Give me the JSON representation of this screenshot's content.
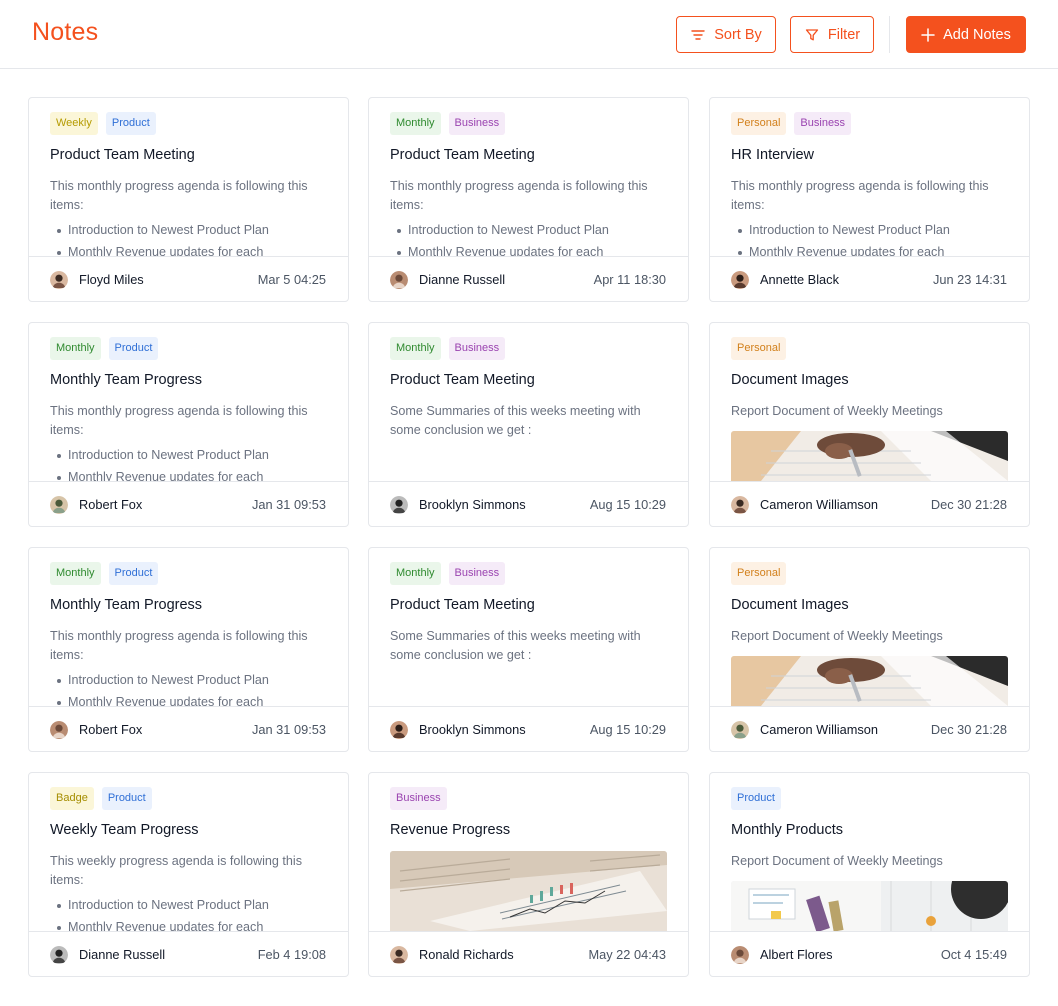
{
  "header": {
    "title": "Notes",
    "sort_label": "Sort By",
    "filter_label": "Filter",
    "add_label": "Add Notes"
  },
  "colors": {
    "accent": "#f4511e"
  },
  "cards": [
    {
      "tags": [
        "Weekly",
        "Product"
      ],
      "title": "Product Team Meeting",
      "text": "This monthly progress agenda is following this items:",
      "list": [
        "Introduction to Newest Product Plan",
        "Monthly Revenue updates for each"
      ],
      "author": "Floyd Miles",
      "date": "Mar 5 04:25"
    },
    {
      "tags": [
        "Monthly",
        "Business"
      ],
      "title": "Product Team Meeting",
      "text": "This monthly progress agenda is following this items:",
      "list": [
        "Introduction to Newest Product Plan",
        "Monthly Revenue updates for each"
      ],
      "author": "Dianne Russell",
      "date": "Apr 11 18:30"
    },
    {
      "tags": [
        "Personal",
        "Business"
      ],
      "title": "HR Interview",
      "text": "This monthly progress agenda is following this items:",
      "list": [
        "Introduction to Newest Product Plan",
        "Monthly Revenue updates for each"
      ],
      "author": "Annette Black",
      "date": "Jun 23 14:31"
    },
    {
      "tags": [
        "Monthly",
        "Product"
      ],
      "title": "Monthly Team Progress",
      "text": "This monthly progress agenda is following this items:",
      "list": [
        "Introduction to Newest Product Plan",
        "Monthly Revenue updates for each"
      ],
      "author": "Robert Fox",
      "date": "Jan 31 09:53"
    },
    {
      "tags": [
        "Monthly",
        "Business"
      ],
      "title": "Product Team Meeting",
      "text": "Some Summaries of this weeks meeting with some conclusion we get :",
      "author": "Brooklyn Simmons",
      "date": "Aug 15 10:29"
    },
    {
      "tags": [
        "Personal"
      ],
      "title": "Document Images",
      "text": "Report Document of Weekly Meetings",
      "image": "writing-photo",
      "author": "Cameron Williamson",
      "date": "Dec 30 21:28"
    },
    {
      "tags": [
        "Monthly",
        "Product"
      ],
      "title": "Monthly Team Progress",
      "text": "This monthly progress agenda is following this items:",
      "list": [
        "Introduction to Newest Product Plan",
        "Monthly Revenue updates for each"
      ],
      "author": "Robert Fox",
      "date": "Jan 31 09:53"
    },
    {
      "tags": [
        "Monthly",
        "Business"
      ],
      "title": "Product Team Meeting",
      "text": "Some Summaries of this weeks meeting with some conclusion we get :",
      "author": "Brooklyn Simmons",
      "date": "Aug 15 10:29"
    },
    {
      "tags": [
        "Personal"
      ],
      "title": "Document Images",
      "text": "Report Document of Weekly Meetings",
      "image": "writing-photo",
      "author": "Cameron Williamson",
      "date": "Dec 30 21:28"
    },
    {
      "tags": [
        "Badge",
        "Product"
      ],
      "title": "Weekly Team Progress",
      "text": "This weekly progress agenda is following this items:",
      "list": [
        "Introduction to Newest Product Plan",
        "Monthly Revenue updates for each"
      ],
      "author": "Dianne Russell",
      "date": "Feb 4 19:08"
    },
    {
      "tags": [
        "Business"
      ],
      "title": "Revenue Progress",
      "image": "newspaper-chart-photo",
      "author": "Ronald Richards",
      "date": "May 22 04:43"
    },
    {
      "tags": [
        "Product"
      ],
      "title": "Monthly Products",
      "text": "Report Document of Weekly Meetings",
      "image": "desk-photo",
      "author": "Albert Flores",
      "date": "Oct 4 15:49"
    }
  ]
}
